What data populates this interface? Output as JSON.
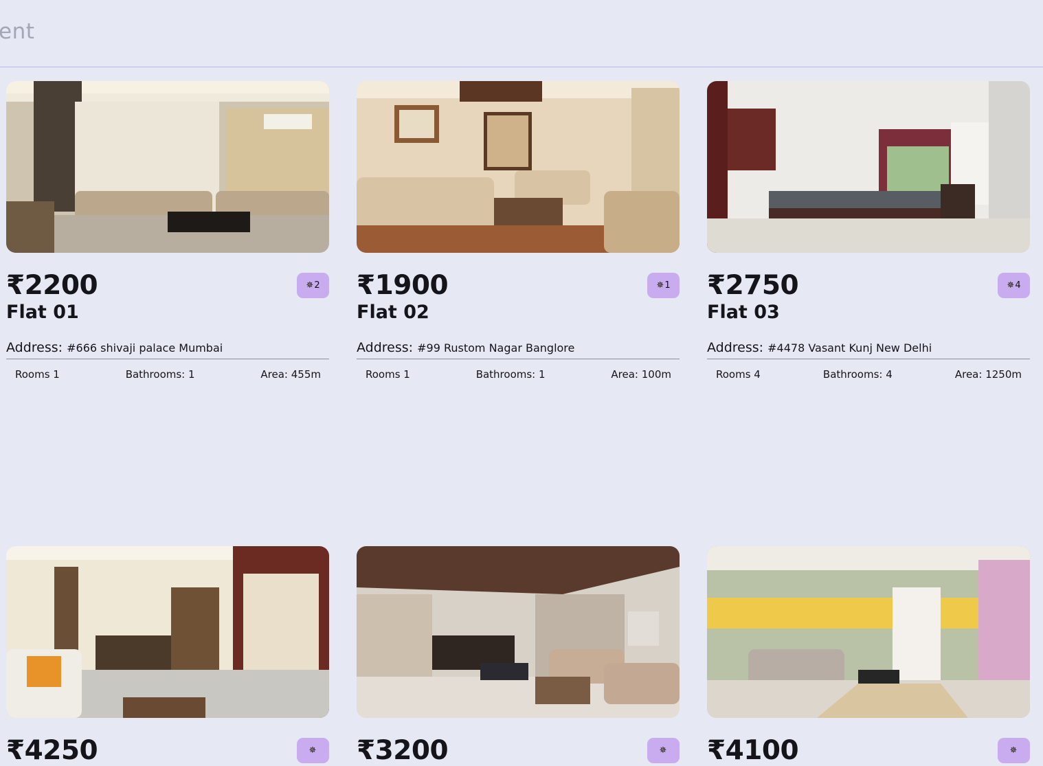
{
  "header": {
    "title": "ent"
  },
  "address_label": "Address:",
  "listings": [
    {
      "price": "₹2200",
      "rating": "2",
      "title": "Flat 01",
      "address": "#666 shivaji palace Mumbai",
      "rooms": "Rooms 1",
      "bathrooms": "Bathrooms: 1",
      "area": "Area: 455m"
    },
    {
      "price": "₹1900",
      "rating": "1",
      "title": "Flat 02",
      "address": "#99 Rustom Nagar Banglore",
      "rooms": "Rooms 1",
      "bathrooms": "Bathrooms: 1",
      "area": "Area: 100m"
    },
    {
      "price": "₹2750",
      "rating": "4",
      "title": "Flat 03",
      "address": "#4478 Vasant Kunj New Delhi",
      "rooms": "Rooms 4",
      "bathrooms": "Bathrooms: 4",
      "area": "Area: 1250m"
    },
    {
      "price": "₹4250"
    },
    {
      "price": "₹3200"
    },
    {
      "price": "₹4100"
    }
  ],
  "icons": {
    "rating": "star-icon"
  },
  "colors": {
    "background": "#e6e9f3",
    "badge": "#c9acf0",
    "divider": "#b8b6ee"
  }
}
